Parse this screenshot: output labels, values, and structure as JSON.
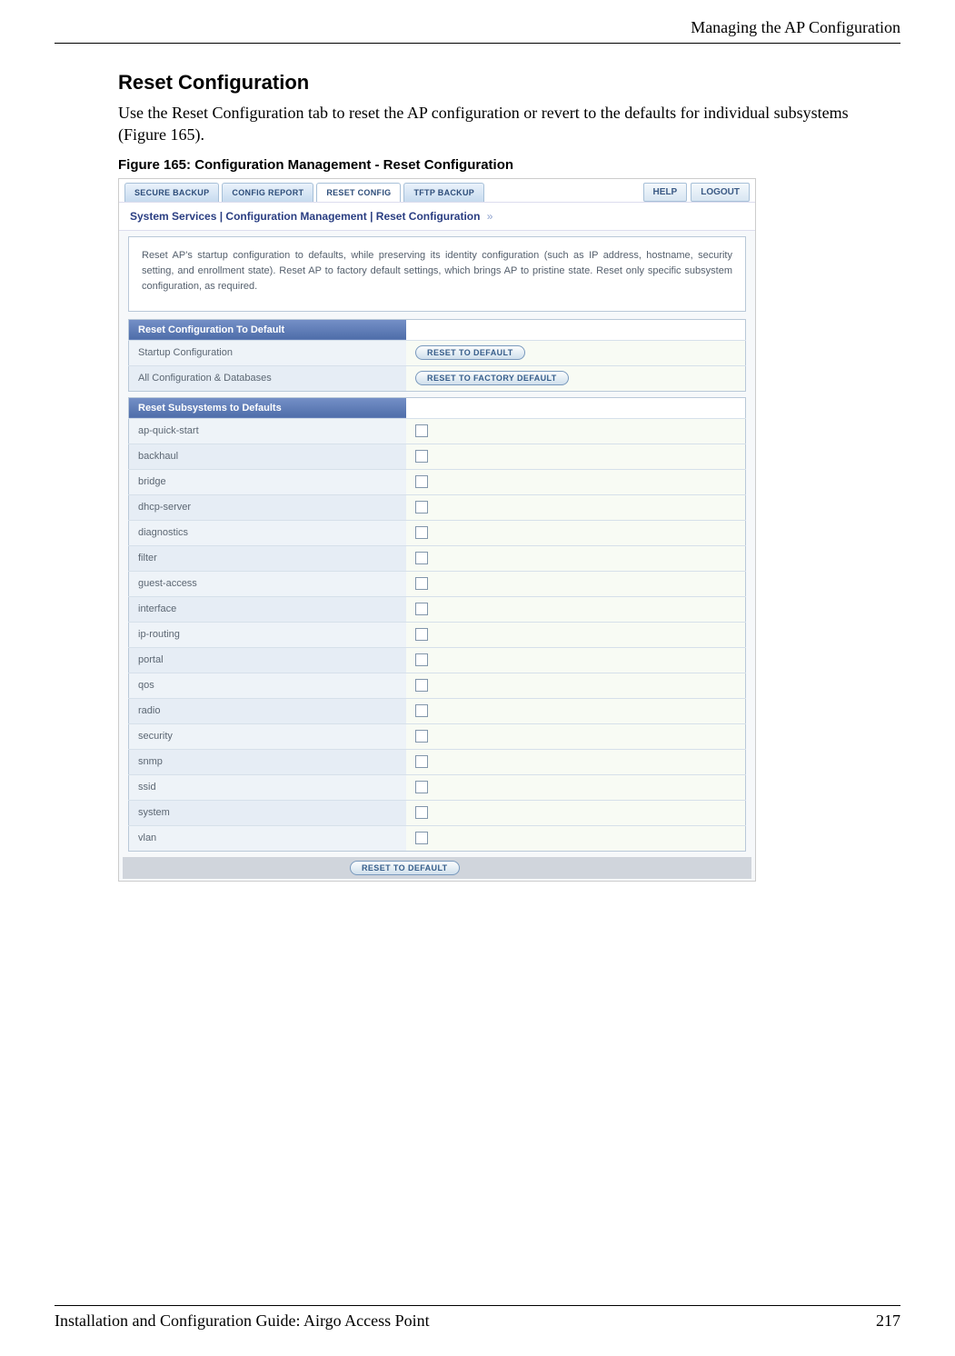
{
  "page": {
    "header_right": "Managing the AP Configuration",
    "footer_left": "Installation and Configuration Guide: Airgo Access Point",
    "footer_right": "217"
  },
  "section": {
    "title": "Reset Configuration",
    "body": "Use the Reset Configuration tab to reset the AP configuration or revert to the defaults for individual subsystems (Figure 165).",
    "figure_caption": "Figure 165:    Configuration Management - Reset Configuration"
  },
  "screenshot": {
    "tabs": [
      {
        "label": "SECURE BACKUP",
        "active": false
      },
      {
        "label": "CONFIG REPORT",
        "active": false
      },
      {
        "label": "RESET CONFIG",
        "active": true
      },
      {
        "label": "TFTP BACKUP",
        "active": false
      }
    ],
    "actions": {
      "help": "HELP",
      "logout": "LOGOUT"
    },
    "breadcrumb": "System Services | Configuration Management | Reset Configuration",
    "desc": "Reset AP's startup configuration to defaults, while preserving its identity configuration (such as IP address, hostname, security setting, and enrollment state). Reset AP to factory default settings, which brings AP to pristine state. Reset only specific subsystem configuration, as required.",
    "section1": {
      "header": "Reset Configuration To Default",
      "rows": [
        {
          "label": "Startup Configuration",
          "button": "RESET TO DEFAULT"
        },
        {
          "label": "All Configuration & Databases",
          "button": "RESET TO FACTORY DEFAULT"
        }
      ]
    },
    "section2": {
      "header": "Reset Subsystems to Defaults",
      "items": [
        "ap-quick-start",
        "backhaul",
        "bridge",
        "dhcp-server",
        "diagnostics",
        "filter",
        "guest-access",
        "interface",
        "ip-routing",
        "portal",
        "qos",
        "radio",
        "security",
        "snmp",
        "ssid",
        "system",
        "vlan"
      ],
      "footer_button": "RESET TO DEFAULT"
    }
  }
}
